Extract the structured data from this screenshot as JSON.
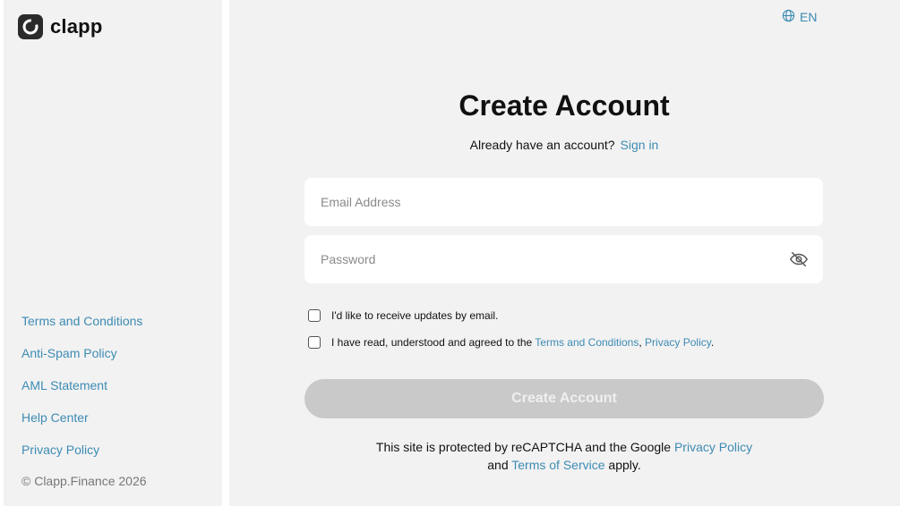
{
  "brand": {
    "name": "clapp"
  },
  "sidebar": {
    "links": [
      {
        "label": "Terms and Conditions"
      },
      {
        "label": "Anti-Spam Policy"
      },
      {
        "label": "AML Statement"
      },
      {
        "label": "Help Center"
      },
      {
        "label": "Privacy Policy"
      }
    ],
    "copyright": "© Clapp.Finance 2026"
  },
  "header": {
    "language": "EN"
  },
  "form": {
    "title": "Create Account",
    "signin_prompt": "Already have an account?",
    "signin_link": "Sign in",
    "email": {
      "placeholder": "Email Address",
      "value": ""
    },
    "password": {
      "placeholder": "Password",
      "value": ""
    },
    "checkbox_updates": "I'd like to receive updates by email.",
    "checkbox_terms_prefix": "I have read, understood and agreed to the",
    "checkbox_terms_link1": "Terms and Conditions",
    "checkbox_terms_sep": ",",
    "checkbox_terms_link2": "Privacy Policy",
    "checkbox_terms_suffix": ".",
    "submit_label": "Create Account"
  },
  "recaptcha": {
    "line1": "This site is protected by reCAPTCHA and the Google",
    "privacy_link": "Privacy Policy",
    "and": "and",
    "terms_link": "Terms of Service",
    "apply": "apply."
  },
  "colors": {
    "accent": "#3d8bb3",
    "background": "#f2f2f2",
    "button_disabled": "#c9c9c9"
  },
  "icons": {
    "logo": "clapp-logo-icon",
    "language": "globe-icon",
    "password_toggle": "eye-off-icon"
  }
}
